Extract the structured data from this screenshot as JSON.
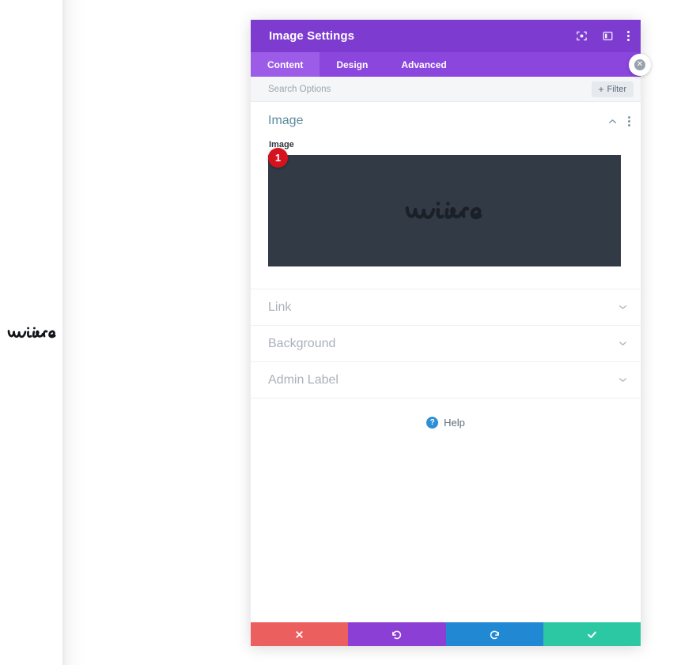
{
  "page": {
    "logo_alt": "wire-logo"
  },
  "modal": {
    "title": "Image Settings",
    "header_icons": [
      {
        "name": "fullscreen-target-icon"
      },
      {
        "name": "panel-layout-icon"
      },
      {
        "name": "more-options-icon"
      }
    ],
    "close_label": "✕",
    "tabs": [
      {
        "label": "Content",
        "active": true
      },
      {
        "label": "Design",
        "active": false
      },
      {
        "label": "Advanced",
        "active": false
      }
    ],
    "search": {
      "placeholder": "Search Options",
      "value": ""
    },
    "filter": {
      "plus": "+",
      "label": "Filter"
    },
    "sections": {
      "image": {
        "title": "Image",
        "field_label": "Image",
        "badge": "1",
        "preview_bg": "#323a45",
        "preview_logo_alt": "wire-logo"
      },
      "collapsed": [
        {
          "label": "Link"
        },
        {
          "label": "Background"
        },
        {
          "label": "Admin Label"
        }
      ]
    },
    "help": {
      "icon_glyph": "?",
      "label": "Help"
    },
    "footer": [
      {
        "name": "cancel-button",
        "color": "#ec5f5f",
        "icon": "close-x-icon"
      },
      {
        "name": "undo-button",
        "color": "#8c3fd4",
        "icon": "undo-icon"
      },
      {
        "name": "redo-button",
        "color": "#2188d3",
        "icon": "redo-icon"
      },
      {
        "name": "save-button",
        "color": "#2cc8a3",
        "icon": "check-icon"
      }
    ]
  },
  "colors": {
    "header_purple": "#7e3bd0",
    "tabbar_purple": "#8a46dd",
    "tab_active_purple": "#9c5ce8",
    "section_title_blue": "#5b8ba0",
    "badge_red": "#d5131f",
    "help_blue": "#2d8fd5"
  }
}
